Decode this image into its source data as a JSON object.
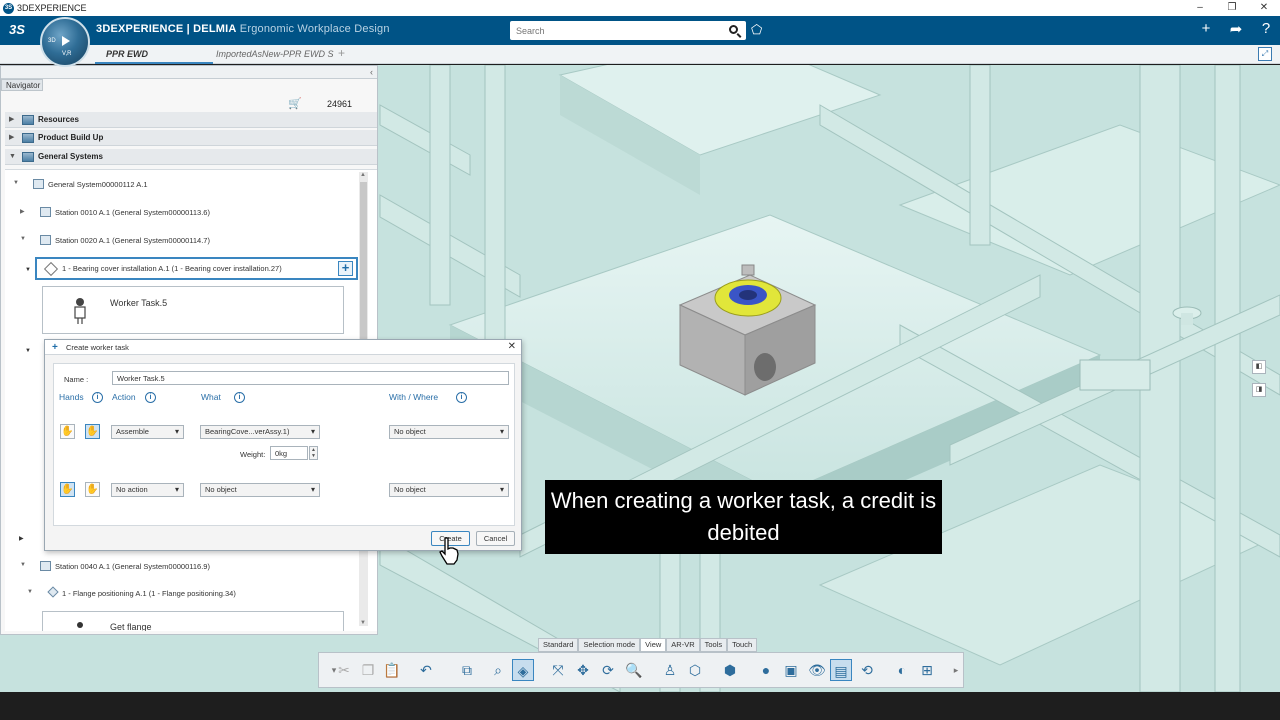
{
  "window": {
    "title": "3DEXPERIENCE"
  },
  "app": {
    "logo": "3S",
    "compass_top": "3D",
    "compass_bottom": "V,R",
    "brand_main": "3DEXPERIENCE | DELMIA",
    "brand_sub": "Ergonomic Workplace Design",
    "search_placeholder": "Search"
  },
  "tabs": [
    {
      "label": "PPR EWD"
    },
    {
      "label": "ImportedAsNew-PPR EWD S"
    }
  ],
  "navigator": {
    "tab_label": "Navigator",
    "credits": "24961",
    "categories": [
      {
        "label": "Resources"
      },
      {
        "label": "Product Build Up"
      },
      {
        "label": "General Systems"
      }
    ],
    "tree": [
      {
        "label": "General System00000112 A.1"
      },
      {
        "label": "Station 0010 A.1 (General System00000113.6)"
      },
      {
        "label": "Station 0020 A.1 (General System00000114.7)"
      },
      {
        "label": "1 - Bearing cover installation A.1 (1 - Bearing cover installation.27)"
      },
      {
        "label": "Station 0040 A.1 (General System00000116.9)"
      },
      {
        "label": "1 - Flange positioning A.1 (1 - Flange positioning.34)"
      }
    ],
    "worker_task": "Worker Task.5",
    "partial_task": "Get flange"
  },
  "dialog": {
    "title": "Create worker task",
    "name_label": "Name :",
    "name_value": "Worker Task.5",
    "hands_label": "Hands",
    "action_label": "Action",
    "what_label": "What",
    "with_where_label": "With / Where",
    "row1": {
      "action": "Assemble",
      "what": "BearingCove...verAssy.1)",
      "with": "No object"
    },
    "weight_label": "Weight:",
    "weight_value": "0kg",
    "row2": {
      "action": "No action",
      "what": "No object",
      "with": "No object"
    },
    "create_label": "Create",
    "cancel_label": "Cancel"
  },
  "caption": "When creating a worker task, a credit is debited",
  "action_tabs": [
    "Standard",
    "Selection mode",
    "View",
    "AR-VR",
    "Tools",
    "Touch"
  ],
  "colors": {
    "brand": "#005386",
    "accent": "#3a86c0",
    "viewport": "#c8e3df"
  }
}
